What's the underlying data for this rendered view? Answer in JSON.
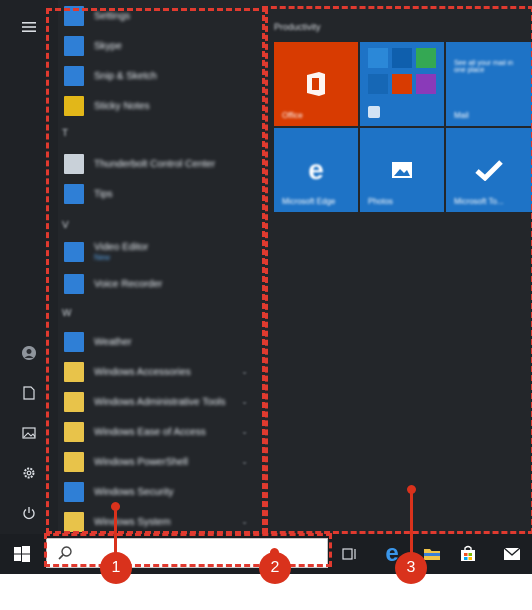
{
  "colors": {
    "annotation": "#d9321c",
    "office": "#d83b01",
    "tile_blue": "#1e73c6",
    "taskbar": "#1b1e22",
    "start_bg": "#23262a"
  },
  "left_rail": {
    "items": [
      {
        "icon": "hamburger-menu-icon"
      },
      {
        "icon": "user-avatar-icon"
      },
      {
        "icon": "documents-icon"
      },
      {
        "icon": "pictures-icon"
      },
      {
        "icon": "settings-gear-icon"
      },
      {
        "icon": "power-icon"
      }
    ]
  },
  "app_list": {
    "letters": [
      "T",
      "V",
      "W"
    ],
    "apps": [
      {
        "label": "Settings",
        "sub": "",
        "color": "#2f7fd6"
      },
      {
        "label": "Skype",
        "sub": "",
        "color": "#2f7fd6"
      },
      {
        "label": "Snip & Sketch",
        "sub": "",
        "color": "#2f7fd6"
      },
      {
        "label": "Sticky Notes",
        "sub": "",
        "color": "#e2b719"
      },
      {
        "label": "Thunderbolt Control Center",
        "sub": "",
        "color": "#c9d1d9"
      },
      {
        "label": "Tips",
        "sub": "",
        "color": "#2f7fd6"
      },
      {
        "label": "Video Editor",
        "sub": "New",
        "color": "#2f7fd6"
      },
      {
        "label": "Voice Recorder",
        "sub": "",
        "color": "#2f7fd6"
      },
      {
        "label": "Weather",
        "sub": "",
        "color": "#2f7fd6"
      },
      {
        "label": "Windows Accessories",
        "sub": "",
        "color": "#e8c34a"
      },
      {
        "label": "Windows Administrative Tools",
        "sub": "",
        "color": "#e8c34a"
      },
      {
        "label": "Windows Ease of Access",
        "sub": "",
        "color": "#e8c34a"
      },
      {
        "label": "Windows PowerShell",
        "sub": "",
        "color": "#e8c34a"
      },
      {
        "label": "Windows Security",
        "sub": "",
        "color": "#2f7fd6"
      },
      {
        "label": "Windows System",
        "sub": "",
        "color": "#e8c34a"
      }
    ]
  },
  "tiles": {
    "group_title": "Productivity",
    "items": [
      {
        "label": "Office",
        "icon": "office-logo-icon"
      },
      {
        "label": "",
        "icon": "app-folder-icon"
      },
      {
        "label": "Mail",
        "icon": "mail-icon",
        "text": "See all your mail in one place"
      },
      {
        "label": "Microsoft Edge",
        "icon": "edge-logo-icon"
      },
      {
        "label": "Photos",
        "icon": "photos-icon"
      },
      {
        "label": "Microsoft To...",
        "icon": "todo-check-icon"
      }
    ]
  },
  "taskbar": {
    "search_placeholder": "",
    "icons": [
      "task-view-icon",
      "edge-taskbar-icon",
      "file-explorer-icon",
      "store-icon",
      "mail-taskbar-icon"
    ]
  },
  "callouts": [
    "1",
    "2",
    "3"
  ]
}
